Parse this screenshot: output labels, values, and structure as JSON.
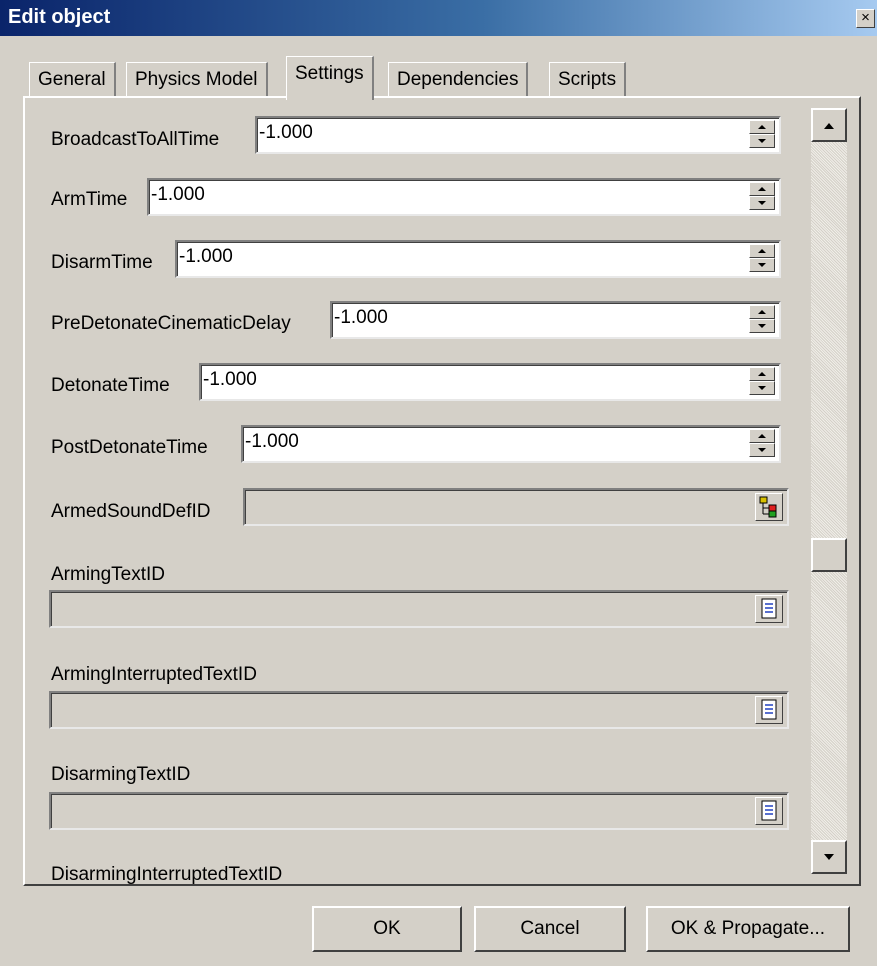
{
  "window": {
    "title": "Edit object",
    "close": "×"
  },
  "tabs": [
    {
      "label": "General"
    },
    {
      "label": "Physics Model"
    },
    {
      "label": "Settings",
      "active": true
    },
    {
      "label": "Dependencies"
    },
    {
      "label": "Scripts"
    }
  ],
  "fields": {
    "broadcast_to_all_time": {
      "label": "BroadcastToAllTime",
      "value": "-1.000"
    },
    "arm_time": {
      "label": "ArmTime",
      "value": "-1.000"
    },
    "disarm_time": {
      "label": "DisarmTime",
      "value": "-1.000"
    },
    "pre_detonate_cinematic_delay": {
      "label": "PreDetonateCinematicDelay",
      "value": "-1.000"
    },
    "detonate_time": {
      "label": "DetonateTime",
      "value": "-1.000"
    },
    "post_detonate_time": {
      "label": "PostDetonateTime",
      "value": "-1.000"
    },
    "armed_sound_def_id": {
      "label": "ArmedSoundDefID",
      "value": ""
    },
    "arming_text_id": {
      "label": "ArmingTextID",
      "value": ""
    },
    "arming_interrupted_text_id": {
      "label": "ArmingInterruptedTextID",
      "value": ""
    },
    "disarming_text_id": {
      "label": "DisarmingTextID",
      "value": ""
    },
    "disarming_interrupted_text_id": {
      "label": "DisarmingInterruptedTextID"
    }
  },
  "buttons": {
    "ok": "OK",
    "cancel": "Cancel",
    "ok_propagate": "OK & Propagate..."
  }
}
